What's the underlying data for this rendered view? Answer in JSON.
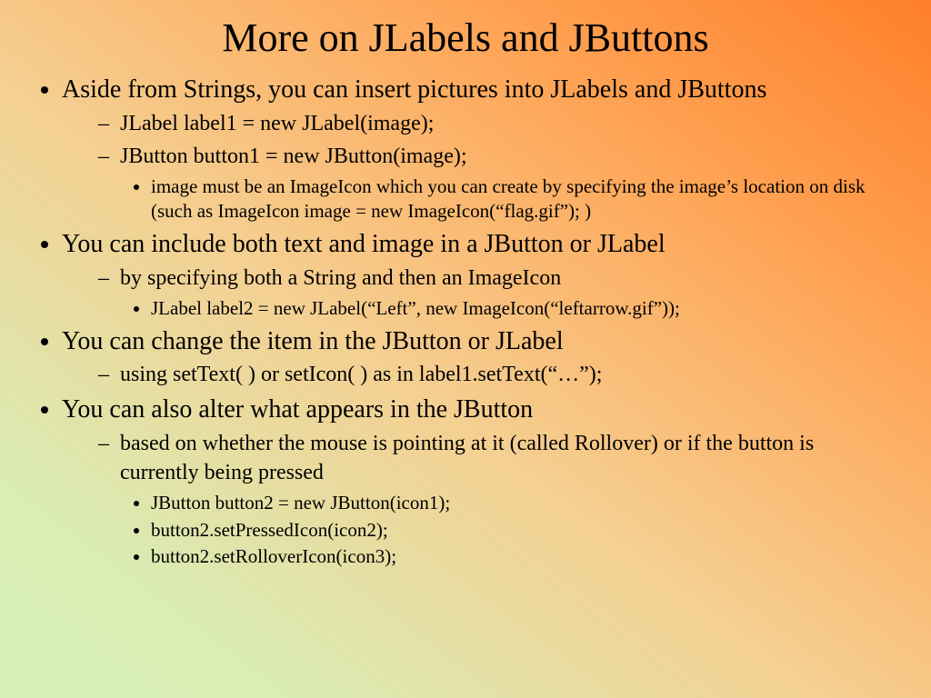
{
  "title": "More on JLabels and JButtons",
  "bullets": {
    "b0": {
      "text": "Aside from Strings, you can insert pictures into JLabels and JButtons",
      "sub": {
        "s0": "JLabel label1 = new JLabel(image);",
        "s1": "JButton button1 = new JButton(image);",
        "s1_sub": {
          "ss0": "image must be an ImageIcon which you can create by specifying the image’s location on disk (such as ImageIcon image = new ImageIcon(“flag.gif”); )"
        }
      }
    },
    "b1": {
      "text": "You can include both text and image in a JButton or JLabel",
      "sub": {
        "s0": "by specifying both a String and then an ImageIcon",
        "s0_sub": {
          "ss0": "JLabel label2 = new JLabel(“Left”, new ImageIcon(“leftarrow.gif”));"
        }
      }
    },
    "b2": {
      "text": "You can change the item in the JButton or JLabel",
      "sub": {
        "s0": "using setText( ) or setIcon( ) as in label1.setText(“…”);"
      }
    },
    "b3": {
      "text": "You can also alter what appears in the JButton",
      "sub": {
        "s0": "based on whether the mouse is pointing at it (called Rollover) or if the button is currently being pressed",
        "s0_sub": {
          "ss0": "JButton button2 = new JButton(icon1);",
          "ss1": "button2.setPressedIcon(icon2);",
          "ss2": "button2.setRolloverIcon(icon3);"
        }
      }
    }
  }
}
